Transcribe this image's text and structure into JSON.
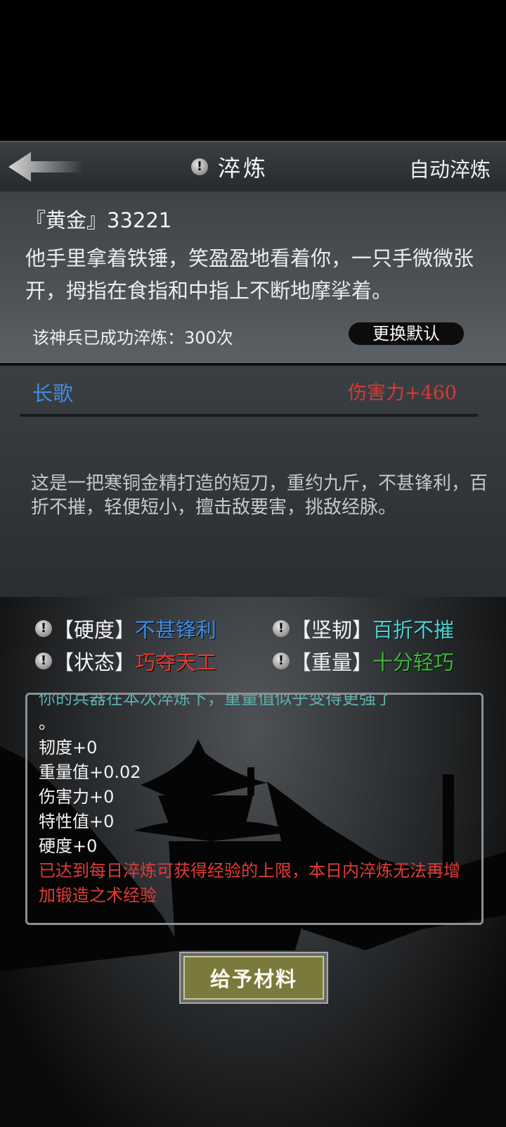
{
  "header": {
    "title": "淬炼",
    "auto_refine_label": "自动淬炼"
  },
  "item": {
    "name": "『黄金』33221",
    "description": "他手里拿着铁锤，笑盈盈地看着你，一只手微微张开，拇指在食指和中指上不断地摩挲着。",
    "refine_count_text": "该神兵已成功淬炼：300次",
    "change_default_label": "更换默认"
  },
  "weapon": {
    "name": "长歌",
    "damage": "伤害力+460",
    "description": "这是一把寒铜金精打造的短刀，重约九斤，不甚锋利，百折不摧，轻便短小，擅击敌要害，挑敌经脉。"
  },
  "attributes": {
    "hardness": {
      "key": "【硬度】",
      "value": "不甚锋利",
      "color": "#3b8ee8"
    },
    "toughness": {
      "key": "【坚韧】",
      "value": "百折不摧",
      "color": "#4fd0d0"
    },
    "state": {
      "key": "【状态】",
      "value": "巧夺天工",
      "color": "#e53a32"
    },
    "weight": {
      "key": "【重量】",
      "value": "十分轻巧",
      "color": "#3db83a"
    }
  },
  "log": {
    "partial_line": "你的兵器在本次淬炼下，重量值似乎变得更强了",
    "period": "。",
    "lines": [
      "韧度+0",
      "重量值+0.02",
      "伤害力+0",
      "特性值+0",
      "硬度+0"
    ],
    "warning": "已达到每日淬炼可获得经验的上限，本日内淬炼无法再增加锻造之术经验"
  },
  "give_material_label": "给予材料",
  "icons": {
    "back": "back-arrow-icon",
    "info": "exclamation-icon"
  }
}
